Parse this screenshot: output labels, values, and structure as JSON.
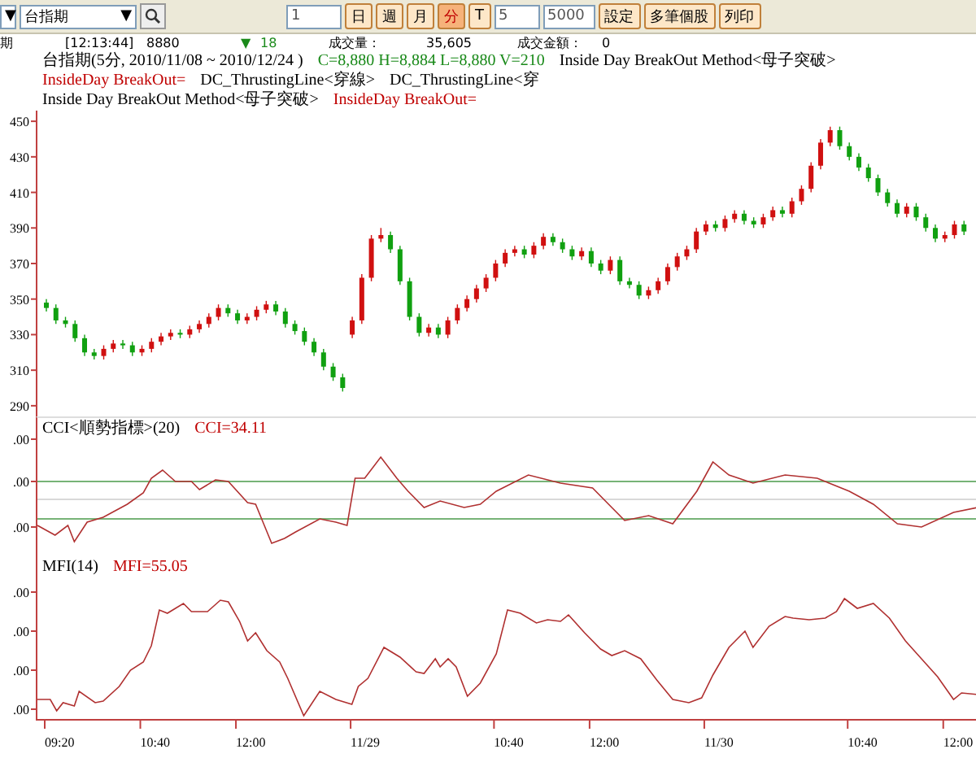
{
  "toolbar": {
    "period_selector": "▼",
    "symbol": "台指期",
    "symbol_arrow": "▼",
    "count": "1",
    "interval_buttons": [
      {
        "label": "日",
        "selected": false
      },
      {
        "label": "週",
        "selected": false
      },
      {
        "label": "月",
        "selected": false
      },
      {
        "label": "分",
        "selected": true
      },
      {
        "label": "T",
        "selected": false
      }
    ],
    "minutes": "5",
    "bars": "5000",
    "actions": [
      "設定",
      "多筆個股",
      "列印"
    ]
  },
  "quote": {
    "name": "期",
    "time": "[12:13:44]",
    "price": "8880",
    "change_arrow": "▼",
    "change": "18",
    "volume_label": "成交量：",
    "volume": "35,605",
    "amount_label": "成交金額：",
    "amount": "0"
  },
  "main_panel": {
    "legend_lines": [
      [
        {
          "text": "台指期(5分, 2010/11/08 ~ 2010/12/24 )",
          "color": "#000000"
        },
        {
          "text": "C=8,880 H=8,884 L=8,880 V=210",
          "color": "#1a8a1a"
        },
        {
          "text": "Inside Day BreakOut Method<母子突破>",
          "color": "#000000"
        },
        {
          "text": "InsideDay BreakOut=",
          "color": "#c00000"
        },
        {
          "text": "DC_ThrustingLine<穿線>",
          "color": "#000000"
        },
        {
          "text": "DC_ThrustingLine<穿",
          "color": "#000000"
        }
      ],
      [
        {
          "text": "Inside Day BreakOut Method<母子突破>",
          "color": "#000000"
        },
        {
          "text": "InsideDay BreakOut=",
          "color": "#c00000"
        }
      ]
    ],
    "chart_data": {
      "type": "candlestick",
      "ohlc": [
        [
          348,
          350,
          343,
          345
        ],
        [
          345,
          347,
          336,
          338
        ],
        [
          338,
          340,
          334,
          336
        ],
        [
          336,
          338,
          326,
          328
        ],
        [
          328,
          330,
          318,
          320
        ],
        [
          320,
          322,
          316,
          318
        ],
        [
          318,
          324,
          316,
          322
        ],
        [
          322,
          327,
          320,
          325
        ],
        [
          325,
          327,
          322,
          324
        ],
        [
          324,
          326,
          318,
          320
        ],
        [
          320,
          324,
          318,
          322
        ],
        [
          322,
          328,
          320,
          326
        ],
        [
          326,
          331,
          324,
          329
        ],
        [
          329,
          333,
          327,
          331
        ],
        [
          331,
          333,
          328,
          330
        ],
        [
          330,
          335,
          328,
          333
        ],
        [
          333,
          338,
          331,
          336
        ],
        [
          336,
          342,
          334,
          340
        ],
        [
          340,
          347,
          338,
          345
        ],
        [
          345,
          347,
          340,
          342
        ],
        [
          342,
          344,
          336,
          338
        ],
        [
          338,
          342,
          336,
          340
        ],
        [
          340,
          346,
          338,
          344
        ],
        [
          344,
          349,
          342,
          347
        ],
        [
          347,
          349,
          341,
          343
        ],
        [
          343,
          345,
          334,
          336
        ],
        [
          336,
          338,
          330,
          332
        ],
        [
          332,
          334,
          324,
          326
        ],
        [
          326,
          328,
          318,
          320
        ],
        [
          320,
          322,
          310,
          312
        ],
        [
          312,
          314,
          304,
          306
        ],
        [
          306,
          308,
          298,
          300
        ],
        [
          330,
          340,
          328,
          338
        ],
        [
          338,
          364,
          336,
          362
        ],
        [
          362,
          386,
          360,
          384
        ],
        [
          384,
          390,
          382,
          386
        ],
        [
          386,
          388,
          376,
          378
        ],
        [
          378,
          380,
          358,
          360
        ],
        [
          360,
          362,
          338,
          340
        ],
        [
          340,
          342,
          329,
          331
        ],
        [
          331,
          336,
          329,
          334
        ],
        [
          334,
          336,
          328,
          330
        ],
        [
          330,
          340,
          328,
          338
        ],
        [
          338,
          347,
          336,
          345
        ],
        [
          345,
          352,
          343,
          350
        ],
        [
          350,
          358,
          348,
          356
        ],
        [
          356,
          364,
          354,
          362
        ],
        [
          362,
          372,
          360,
          370
        ],
        [
          370,
          378,
          368,
          376
        ],
        [
          376,
          380,
          374,
          378
        ],
        [
          378,
          380,
          373,
          375
        ],
        [
          375,
          382,
          373,
          380
        ],
        [
          380,
          387,
          378,
          385
        ],
        [
          385,
          387,
          380,
          382
        ],
        [
          382,
          384,
          376,
          378
        ],
        [
          378,
          380,
          372,
          374
        ],
        [
          374,
          379,
          372,
          377
        ],
        [
          377,
          379,
          368,
          370
        ],
        [
          370,
          372,
          364,
          366
        ],
        [
          366,
          374,
          364,
          372
        ],
        [
          372,
          374,
          358,
          360
        ],
        [
          360,
          362,
          356,
          358
        ],
        [
          358,
          360,
          350,
          352
        ],
        [
          352,
          357,
          350,
          355
        ],
        [
          355,
          362,
          353,
          360
        ],
        [
          360,
          370,
          358,
          368
        ],
        [
          368,
          376,
          366,
          374
        ],
        [
          374,
          380,
          372,
          378
        ],
        [
          378,
          390,
          376,
          388
        ],
        [
          388,
          394,
          386,
          392
        ],
        [
          392,
          394,
          388,
          390
        ],
        [
          390,
          397,
          388,
          395
        ],
        [
          395,
          400,
          393,
          398
        ],
        [
          398,
          400,
          392,
          394
        ],
        [
          394,
          396,
          390,
          392
        ],
        [
          392,
          398,
          390,
          396
        ],
        [
          396,
          402,
          394,
          400
        ],
        [
          400,
          402,
          396,
          398
        ],
        [
          398,
          407,
          396,
          405
        ],
        [
          405,
          414,
          403,
          412
        ],
        [
          412,
          427,
          410,
          425
        ],
        [
          425,
          440,
          423,
          438
        ],
        [
          438,
          447,
          436,
          445
        ],
        [
          445,
          447,
          434,
          436
        ],
        [
          436,
          438,
          428,
          430
        ],
        [
          430,
          432,
          422,
          424
        ],
        [
          424,
          426,
          416,
          418
        ],
        [
          418,
          420,
          408,
          410
        ],
        [
          410,
          412,
          402,
          404
        ],
        [
          404,
          406,
          396,
          398
        ],
        [
          398,
          404,
          396,
          402
        ],
        [
          402,
          404,
          394,
          396
        ],
        [
          396,
          398,
          388,
          390
        ],
        [
          390,
          392,
          382,
          384
        ],
        [
          384,
          388,
          382,
          386
        ],
        [
          386,
          394,
          384,
          392
        ],
        [
          392,
          394,
          386,
          388
        ]
      ],
      "ylim": [
        284,
        456
      ],
      "yticks": [
        {
          "value": 450,
          "label": "450"
        },
        {
          "value": 430,
          "label": "430"
        },
        {
          "value": 410,
          "label": "410"
        },
        {
          "value": 390,
          "label": "390"
        },
        {
          "value": 370,
          "label": "370"
        },
        {
          "value": 350,
          "label": "350"
        },
        {
          "value": 330,
          "label": "330"
        },
        {
          "value": 310,
          "label": "310"
        },
        {
          "value": 290,
          "label": "290"
        }
      ]
    }
  },
  "cci_panel": {
    "legend": [
      {
        "text": "CCI<順勢指標>(20)",
        "color": "#000000"
      },
      {
        "text": "CCI=34.11",
        "color": "#c00000"
      }
    ],
    "y_ticks": [
      ".00",
      ".00",
      ".00"
    ]
  },
  "mfi_panel": {
    "legend": [
      {
        "text": "MFI(14)",
        "color": "#000000"
      },
      {
        "text": "MFI=55.05",
        "color": "#c00000"
      }
    ],
    "y_ticks": [
      ".00",
      ".00",
      ".00",
      ".00"
    ]
  },
  "x_axis": {
    "labels": [
      "09:20",
      "10:40",
      "12:00",
      "11/29",
      "10:40",
      "12:00",
      "11/30",
      "10:40",
      "12:00"
    ]
  }
}
